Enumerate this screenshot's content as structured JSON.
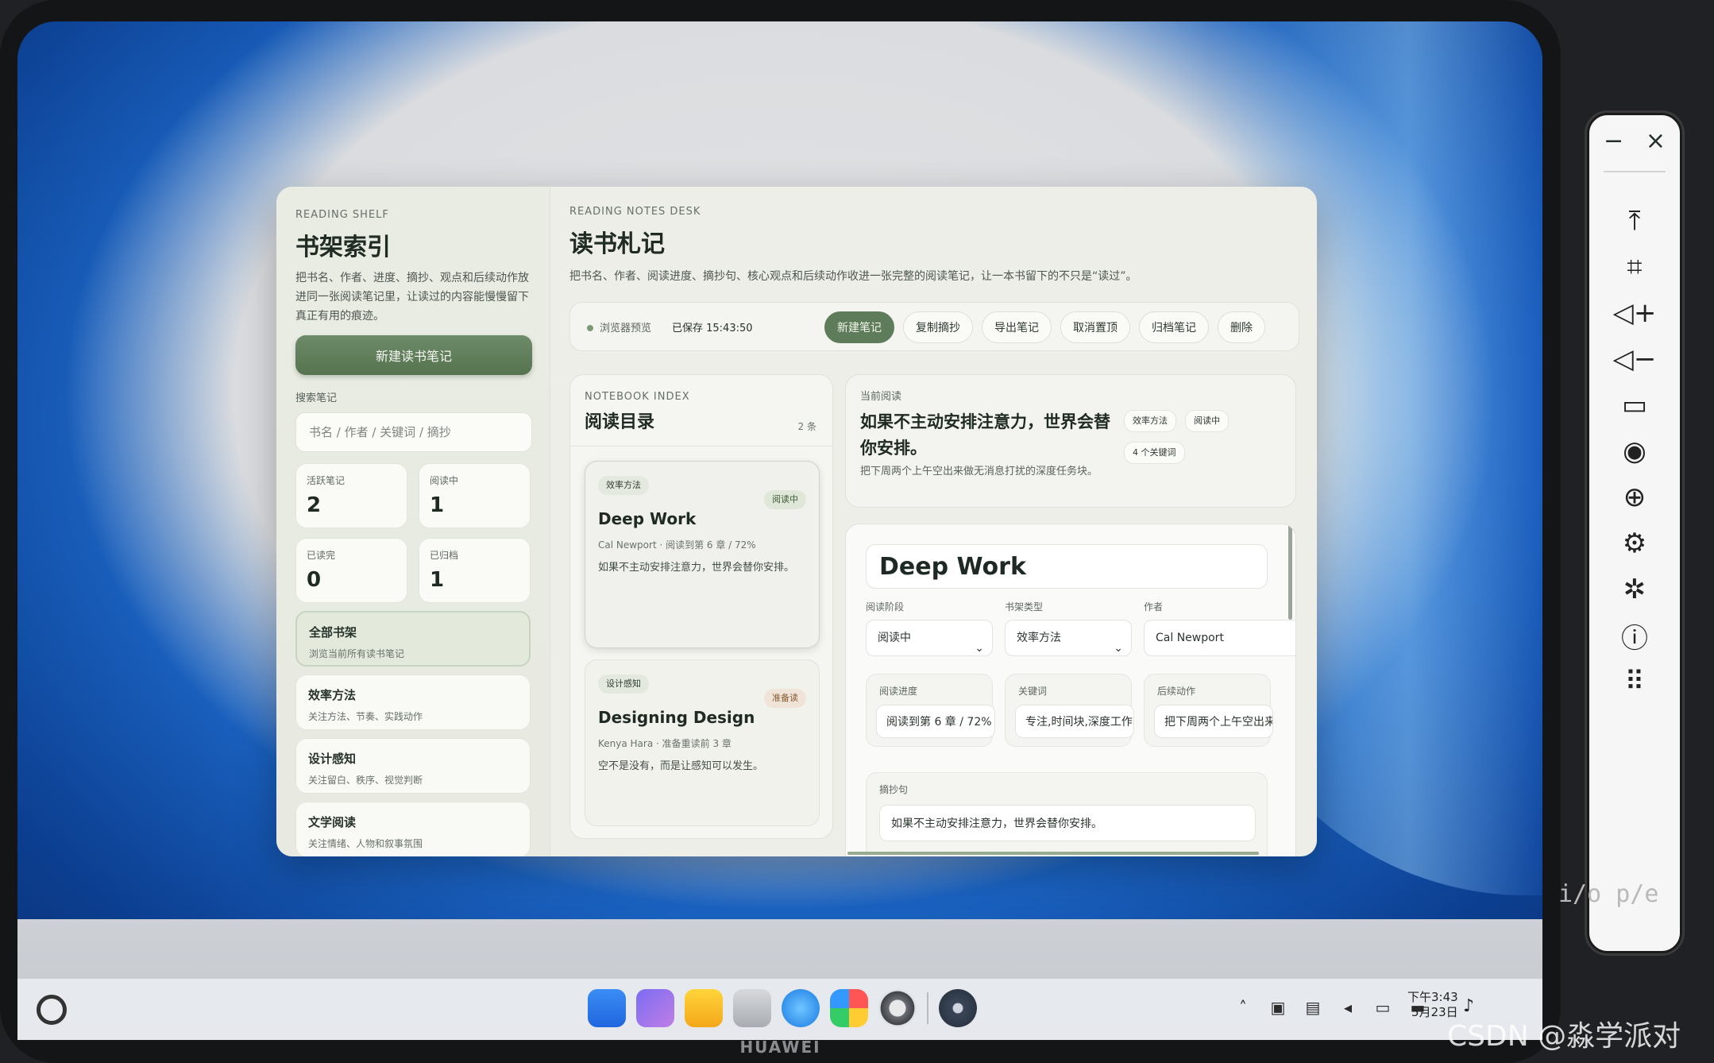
{
  "shelf": {
    "eyebrow": "READING SHELF",
    "title": "书架索引",
    "description": "把书名、作者、进度、摘抄、观点和后续动作放进同一张阅读笔记里，让读过的内容能慢慢留下真正有用的痕迹。",
    "new_button": "新建读书笔记",
    "search_label": "搜索笔记",
    "search_placeholder": "书名 / 作者 / 关键词 / 摘抄",
    "stats": [
      {
        "label": "活跃笔记",
        "value": "2"
      },
      {
        "label": "阅读中",
        "value": "1"
      },
      {
        "label": "已读完",
        "value": "0"
      },
      {
        "label": "已归档",
        "value": "1"
      }
    ],
    "categories": [
      {
        "title": "全部书架",
        "subtitle": "浏览当前所有读书笔记"
      },
      {
        "title": "效率方法",
        "subtitle": "关注方法、节奏、实践动作"
      },
      {
        "title": "设计感知",
        "subtitle": "关注留白、秩序、视觉判断"
      },
      {
        "title": "文学阅读",
        "subtitle": "关注情绪、人物和叙事氛围"
      }
    ]
  },
  "desk": {
    "eyebrow": "READING NOTES DESK",
    "title": "读书札记",
    "description": "把书名、作者、阅读进度、摘抄句、核心观点和后续动作收进一张完整的阅读笔记，让一本书留下的不只是“读过”。",
    "preview_label": "浏览器预览",
    "saved_label": "已保存 15:43:50",
    "buttons": [
      "新建笔记",
      "复制摘抄",
      "导出笔记",
      "取消置顶",
      "归档笔记",
      "删除"
    ]
  },
  "index": {
    "eyebrow": "NOTEBOOK INDEX",
    "title": "阅读目录",
    "count": "2 条",
    "books": [
      {
        "tag": "效率方法",
        "status": "阅读中",
        "title": "Deep Work",
        "meta": "Cal Newport · 阅读到第 6 章 / 72%",
        "excerpt": "如果不主动安排注意力，世界会替你安排。"
      },
      {
        "tag": "设计感知",
        "status": "准备读",
        "title": "Designing Design",
        "meta": "Kenya Hara · 准备重读前 3 章",
        "excerpt": "空不是没有，而是让感知可以发生。"
      }
    ]
  },
  "current": {
    "eyebrow": "当前阅读",
    "title": "如果不主动安排注意力，世界会替你安排。",
    "description": "把下周两个上午空出来做无消息打扰的深度任务块。",
    "tags": [
      "效率方法",
      "阅读中",
      "4 个关键词"
    ]
  },
  "editor": {
    "title": "Deep Work",
    "stage_label": "阅读阶段",
    "stage_value": "阅读中",
    "type_label": "书架类型",
    "type_value": "效率方法",
    "author_label": "作者",
    "author_value": "Cal Newport",
    "progress_label": "阅读进度",
    "progress_value": "阅读到第 6 章 / 72%",
    "keywords_label": "关键词",
    "keywords_value": "专注,时间块,深度工作",
    "action_label": "后续动作",
    "action_value": "把下周两个上午空出来",
    "excerpt_label": "摘抄句",
    "excerpt_value": "如果不主动安排注意力，世界会替你安排。"
  },
  "taskbar": {
    "time": "下午3:43",
    "date": "5月23日",
    "brand": "HUAWEI"
  },
  "overlay": {
    "terminal_text": "i/o        p/e",
    "watermark": "CSDN @淼学派对"
  }
}
